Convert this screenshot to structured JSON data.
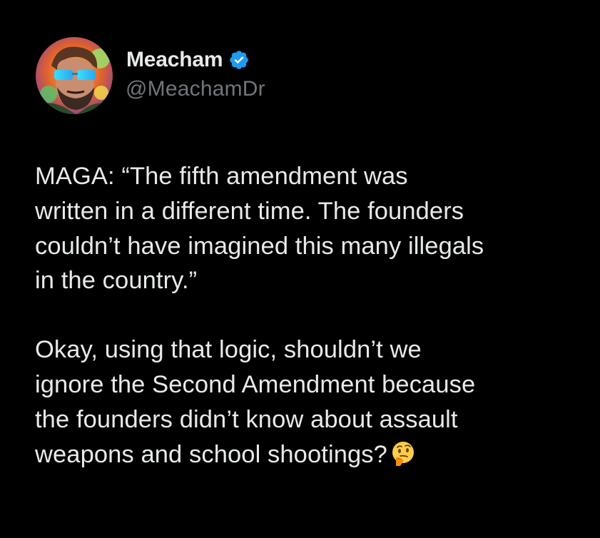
{
  "author": {
    "display_name": "Meacham",
    "handle": "@MeachamDr",
    "verified": true,
    "verified_color": "#1d9bf0"
  },
  "tweet": {
    "paragraph_1": [
      "MAGA: “The fifth amendment was",
      "written in a different time. The founders",
      "couldn’t have imagined this many illegals",
      "in the country.”"
    ],
    "paragraph_2": [
      "Okay, using that logic, shouldn’t we",
      "ignore the Second Amendment because",
      "the founders didn’t know about assault",
      "weapons and school shootings?"
    ],
    "trailing_emoji": "thinking-face-icon"
  },
  "colors": {
    "background": "#000000",
    "text_primary": "#e7e9ea",
    "text_secondary": "#71767b"
  }
}
